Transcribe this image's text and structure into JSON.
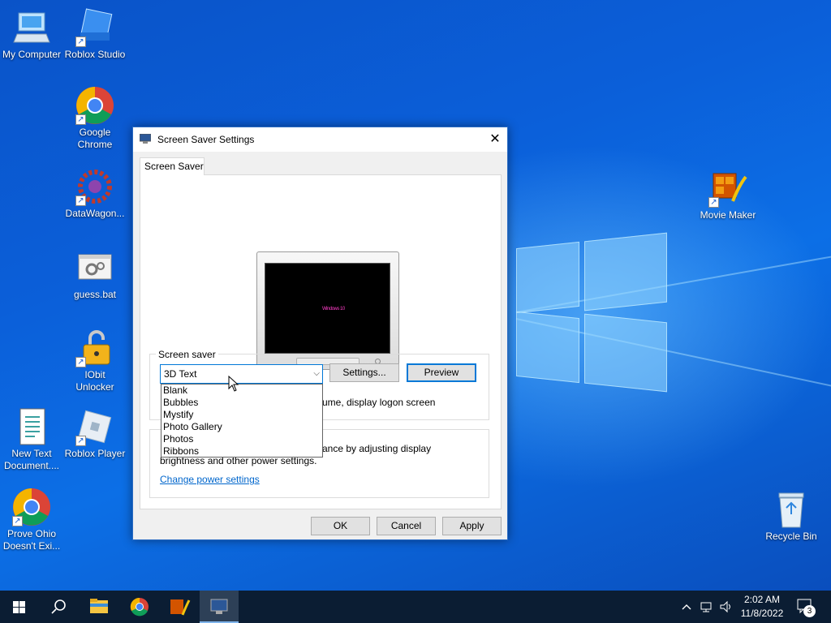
{
  "desktop": {
    "icons": [
      {
        "label": "My Computer"
      },
      {
        "label": "Roblox Studio"
      },
      {
        "label": "Google Chrome"
      },
      {
        "label": "DataWagon..."
      },
      {
        "label": "guess.bat"
      },
      {
        "label": "IObit Unlocker"
      },
      {
        "label": "New Text Document...."
      },
      {
        "label": "Roblox Player"
      },
      {
        "label": "Prove Ohio Doesn't Exi..."
      },
      {
        "label": "Movie Maker"
      },
      {
        "label": "Recycle Bin"
      }
    ]
  },
  "dialog": {
    "title": "Screen Saver Settings",
    "close_glyph": "✕",
    "tab_label": "Screen Saver",
    "screen_saver_group_label": "Screen saver",
    "selected_saver": "3D Text",
    "settings_button": "Settings...",
    "preview_button": "Preview",
    "resume_text": "ume, display logon screen",
    "power_text_line1": "ance by adjusting display",
    "power_text_line2": "brightness and other power settings.",
    "change_power_link": "Change power settings",
    "ok_button": "OK",
    "cancel_button": "Cancel",
    "apply_button": "Apply",
    "dropdown_options": [
      "Blank",
      "Bubbles",
      "Mystify",
      "Photo Gallery",
      "Photos",
      "Ribbons"
    ],
    "preview_text": "Windows 10"
  },
  "taskbar": {
    "time": "2:02 AM",
    "date": "11/8/2022",
    "notification_count": "3"
  },
  "colors": {
    "accent": "#0078d7",
    "taskbar": "#0b1d33",
    "link": "#0066cc"
  }
}
